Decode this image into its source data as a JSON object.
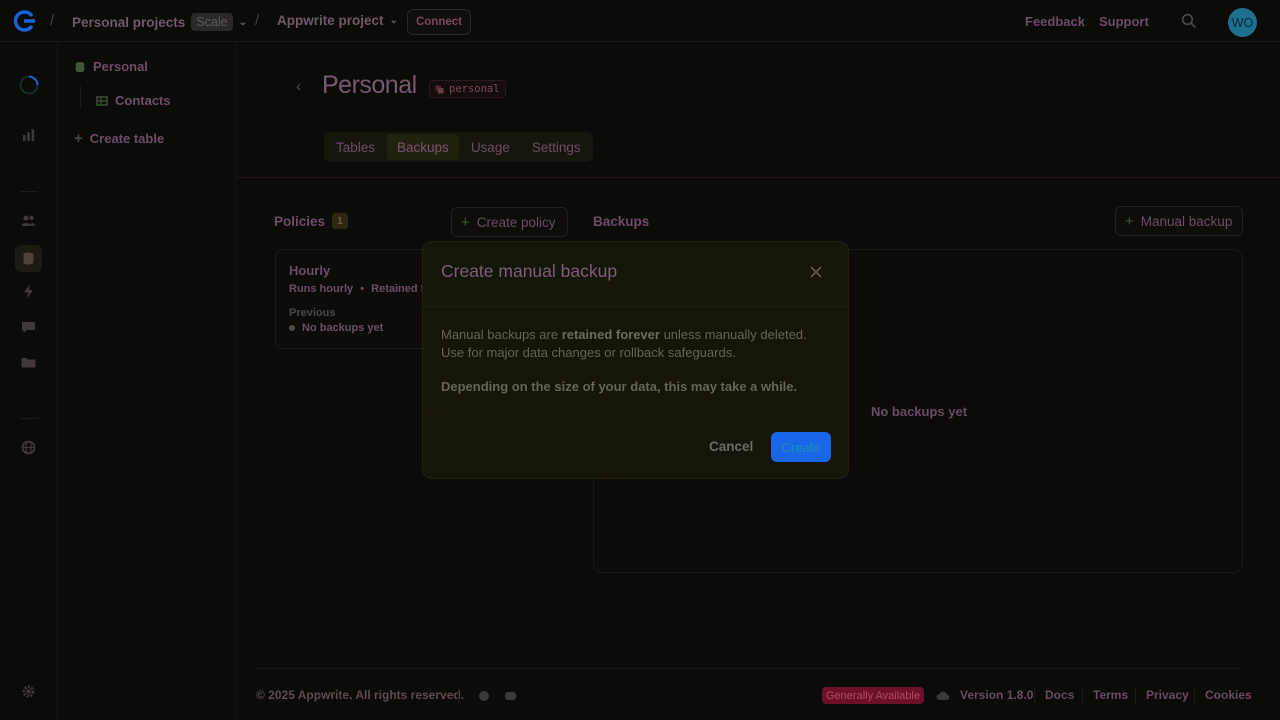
{
  "topbar": {
    "org": "Personal projects",
    "plan": "Scale",
    "project": "Appwrite project",
    "connect_label": "Connect",
    "feedback_label": "Feedback",
    "support_label": "Support",
    "avatar_initials": "WO"
  },
  "sidebar": {
    "database": "Personal",
    "table": "Contacts",
    "create_table": "Create table"
  },
  "page": {
    "title": "Personal",
    "id_badge": "personal",
    "tabs": [
      "Tables",
      "Backups",
      "Usage",
      "Settings"
    ],
    "active_tab": "Backups"
  },
  "policies": {
    "label": "Policies",
    "count": "1",
    "create_label": "Create policy",
    "card": {
      "name": "Hourly",
      "runs": "Runs hourly",
      "retention": "Retained forever",
      "previous_label": "Previous",
      "previous_value": "No backups yet"
    }
  },
  "backups": {
    "label": "Backups",
    "manual_label": "Manual backup",
    "empty_text": "No backups yet"
  },
  "modal": {
    "title": "Create manual backup",
    "line1_prefix": "Manual backups are ",
    "line1_bold": "retained forever",
    "line1_suffix": " unless manually deleted.",
    "line2": "Use for major data changes or rollback safeguards.",
    "line3": "Depending on the size of your data, this may take a while.",
    "cancel_label": "Cancel",
    "create_label": "Create"
  },
  "footer": {
    "copyright": "© 2025 Appwrite. All rights reserved.",
    "status_badge": "Generally Available",
    "version": "Version 1.8.0",
    "docs": "Docs",
    "terms": "Terms",
    "privacy": "Privacy",
    "cookies": "Cookies"
  },
  "colors": {
    "accent": "#1a66e8",
    "badge_red": "#6c1228",
    "avatar": "#1f6f8e"
  }
}
